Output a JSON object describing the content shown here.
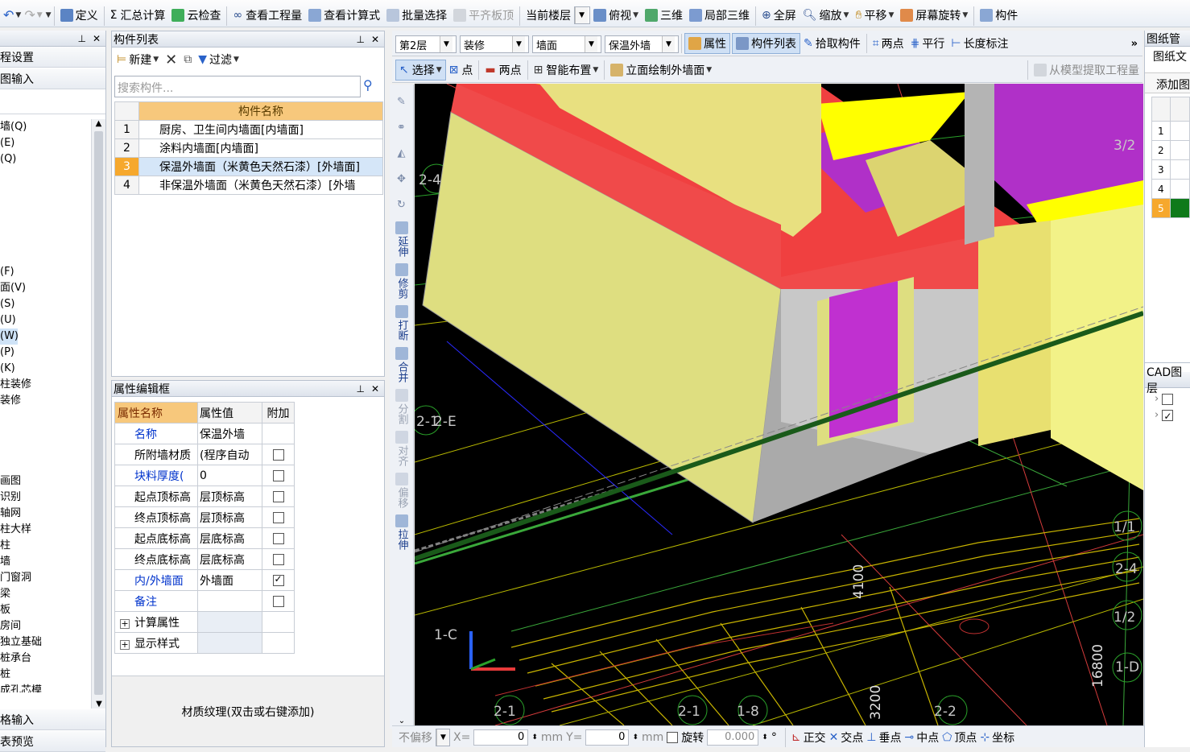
{
  "toolbar": {
    "define": "定义",
    "summary_calc": "汇总计算",
    "cloud_check": "云检查",
    "view_quantity": "查看工程量",
    "view_formula": "查看计算式",
    "batch_select": "批量选择",
    "align_slab_top": "平齐板顶",
    "current_floor": "当前楼层",
    "top_view": "俯视",
    "three_d": "三维",
    "local_3d": "局部三维",
    "fullscreen": "全屏",
    "zoom": "缩放",
    "pan": "平移",
    "screen_rotate": "屏幕旋转",
    "component_short": "构件"
  },
  "left_nav": {
    "section1": "程设置",
    "section2": "图输入",
    "items_top": [
      "墙(Q)",
      "(E)",
      "(Q)"
    ],
    "items_mid": [
      "(F)",
      "面(V)",
      "(S)",
      "(U)",
      "(W)",
      "(P)",
      "(K)",
      "柱装修",
      "装修"
    ],
    "items_low": [
      "画图",
      "识别",
      "轴网",
      "柱大样",
      "柱",
      "墙",
      "门窗洞",
      "梁",
      "板",
      "房间",
      "独立基础",
      "桩承台",
      "桩",
      "成孔芯模"
    ],
    "section3": "格输入",
    "section4": "表预览"
  },
  "component_list": {
    "title": "构件列表",
    "new_label": "新建",
    "filter_label": "过滤",
    "search_placeholder": "搜索构件...",
    "column_header": "构件名称",
    "rows": [
      {
        "n": "1",
        "name": "厨房、卫生间内墙面[内墙面]"
      },
      {
        "n": "2",
        "name": "涂料内墙面[内墙面]"
      },
      {
        "n": "3",
        "name": "保温外墙面（米黄色天然石漆）[外墙面]"
      },
      {
        "n": "4",
        "name": "非保温外墙面（米黄色天然石漆）[外墙"
      }
    ]
  },
  "properties": {
    "title": "属性编辑框",
    "headers": [
      "属性名称",
      "属性值",
      "附加"
    ],
    "rows": [
      {
        "key": "名称",
        "value": "保温外墙",
        "checked": null,
        "blue": true
      },
      {
        "key": "所附墙材质",
        "value": "(程序自动",
        "checked": false,
        "blue": false
      },
      {
        "key": "块料厚度(",
        "value": "0",
        "checked": false,
        "blue": true
      },
      {
        "key": "起点顶标高",
        "value": "层顶标高",
        "checked": false,
        "blue": false
      },
      {
        "key": "终点顶标高",
        "value": "层顶标高",
        "checked": false,
        "blue": false
      },
      {
        "key": "起点底标高",
        "value": "层底标高",
        "checked": false,
        "blue": false
      },
      {
        "key": "终点底标高",
        "value": "层底标高",
        "checked": false,
        "blue": false
      },
      {
        "key": "内/外墙面",
        "value": "外墙面",
        "checked": true,
        "blue": true
      },
      {
        "key": "备注",
        "value": "",
        "checked": false,
        "blue": true
      }
    ],
    "group_calc": "计算属性",
    "group_display": "显示样式",
    "texture_hint": "材质纹理(双击或右键添加)"
  },
  "toolbar2": {
    "floor": "第2层",
    "category": "装修",
    "type": "墙面",
    "component": "保温外墙",
    "attributes": "属性",
    "component_list": "构件列表",
    "pick_component": "拾取构件",
    "two_points": "两点",
    "parallel": "平行",
    "length_annotation": "长度标注"
  },
  "toolbar3": {
    "select": "选择",
    "point": "点",
    "two_points": "两点",
    "smart_layout": "智能布置",
    "elevation_draw": "立面绘制外墙面",
    "extract_from_model": "从模型提取工程量"
  },
  "vertical_tools": [
    "延伸",
    "修剪",
    "打断",
    "合并",
    "分割",
    "对齐",
    "偏移",
    "拉伸"
  ],
  "viewport": {
    "labels": [
      "2-4",
      "2-1",
      "2-E",
      "1-C",
      "2-1",
      "2-2",
      "1-8",
      "1/2",
      "1-D",
      "1/1",
      "2-4",
      "3/2"
    ],
    "dims": [
      "4100",
      "3200",
      "16800"
    ]
  },
  "status": {
    "no_offset": "不偏移",
    "x_label": "X=",
    "x_value": "0",
    "mm": "mm",
    "y_label": "Y=",
    "y_value": "0",
    "rotate": "旋转",
    "rotate_value": "0.000",
    "degree": "°",
    "ortho": "正交",
    "intersection": "交点",
    "perpendicular": "垂点",
    "midpoint": "中点",
    "vertex": "顶点",
    "coordinate": "坐标"
  },
  "right_panel": {
    "title": "图纸管",
    "sub": "图纸文",
    "add": "添加图",
    "rows": [
      "1",
      "2",
      "3",
      "4",
      "5"
    ],
    "cad_layers": "CAD图层"
  }
}
